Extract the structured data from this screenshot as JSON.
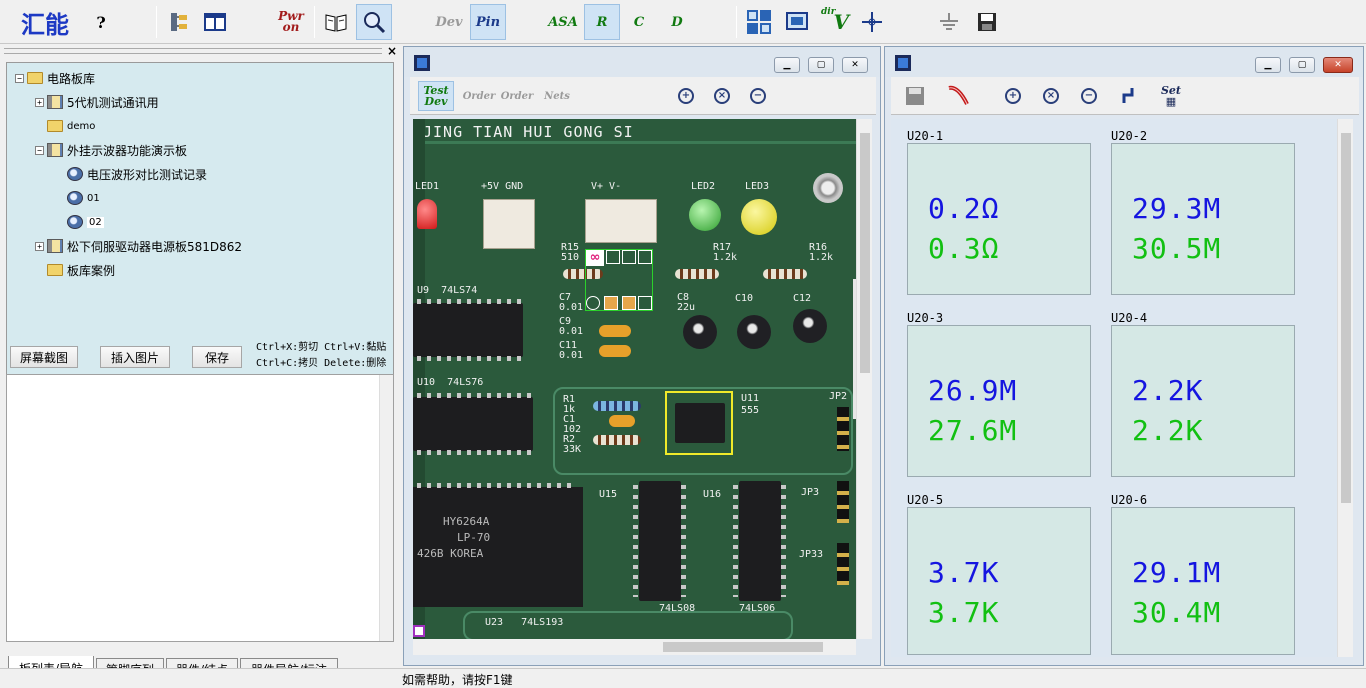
{
  "toolbar": {
    "logo": "汇能",
    "help": "?",
    "pwr_top": "Pwr",
    "pwr_bottom": "on",
    "dev": "Dev",
    "pin": "Pin",
    "asa": "ASA",
    "r": "R",
    "c": "C",
    "d": "D",
    "dirv_sup": "dir",
    "dirv": "V"
  },
  "tree": {
    "root": "电路板库",
    "items": [
      {
        "label": "5代机测试通讯用"
      },
      {
        "label": "demo"
      },
      {
        "label": "外挂示波器功能演示板"
      },
      {
        "label": "电压波形对比测试记录"
      },
      {
        "label": "01"
      },
      {
        "label": "02"
      },
      {
        "label": "松下伺服驱动器电源板581D862"
      },
      {
        "label": "板库案例"
      }
    ]
  },
  "actions": {
    "screenshot": "屏幕截图",
    "insert_image": "插入图片",
    "save": "保存",
    "hint1": "Ctrl+X:剪切 Ctrl+V:黏贴",
    "hint2": "Ctrl+C:拷贝 Delete:删除"
  },
  "tabs": [
    "板列表/导航",
    "管脚序列",
    "器件/结点",
    "器件导航/标注"
  ],
  "board_window": {
    "test_dev_top": "Test",
    "test_dev_bottom": "Dev",
    "order1": "Order",
    "order2": "Order",
    "nets": "Nets"
  },
  "pcb": {
    "header": "JING TIAN HUI GONG SI",
    "labels": {
      "led1": "LED1",
      "pwr": "+5V GND",
      "vpm": "V+   V-",
      "led2": "LED2",
      "led3": "LED3",
      "r15": "R15",
      "r15v": "510",
      "r17": "R17",
      "r17v": "1.2k",
      "r16": "R16",
      "r16v": "1.2k",
      "u9": "U9",
      "u9t": "74LS74",
      "c7": "C7",
      "c7v": "0.01",
      "c9": "C9",
      "c9v": "0.01",
      "c11": "C11",
      "c11v": "0.01",
      "c8": "C8",
      "c8v": "22u",
      "c10": "C10",
      "c12": "C12",
      "u10": "U10",
      "u10t": "74LS76",
      "r1": "R1",
      "r1v": "1k",
      "c1": "C1",
      "c1v": "102",
      "r2": "R2",
      "r2v": "33K",
      "u11": "U11",
      "u11t": "555",
      "jp2": "JP2",
      "ram": "HY6264A",
      "ram2": "LP-70",
      "ram3": "426B  KOREA",
      "u15": "U15",
      "u16": "U16",
      "jp3": "JP3",
      "jp33": "JP33",
      "u23": "U23",
      "u23t": "74LS193",
      "u15t": "74LS08",
      "u16t": "74LS06"
    },
    "marker": "∞"
  },
  "meas_window": {
    "set": "Set",
    "cells": [
      {
        "label": "U20-1",
        "v1": "0.2Ω",
        "v2": "0.3Ω"
      },
      {
        "label": "U20-2",
        "v1": "29.3M",
        "v2": "30.5M"
      },
      {
        "label": "U20-3",
        "v1": "26.9M",
        "v2": "27.6M"
      },
      {
        "label": "U20-4",
        "v1": "2.2K",
        "v2": "2.2K"
      },
      {
        "label": "U20-5",
        "v1": "3.7K",
        "v2": "3.7K"
      },
      {
        "label": "U20-6",
        "v1": "29.1M",
        "v2": "30.4M"
      }
    ]
  },
  "status": "如需帮助，请按F1键",
  "colors": {
    "v1": "#1515e0",
    "v2": "#12c012",
    "tree_bg": "#d6eaef",
    "pcb": "#2b5a3c"
  }
}
